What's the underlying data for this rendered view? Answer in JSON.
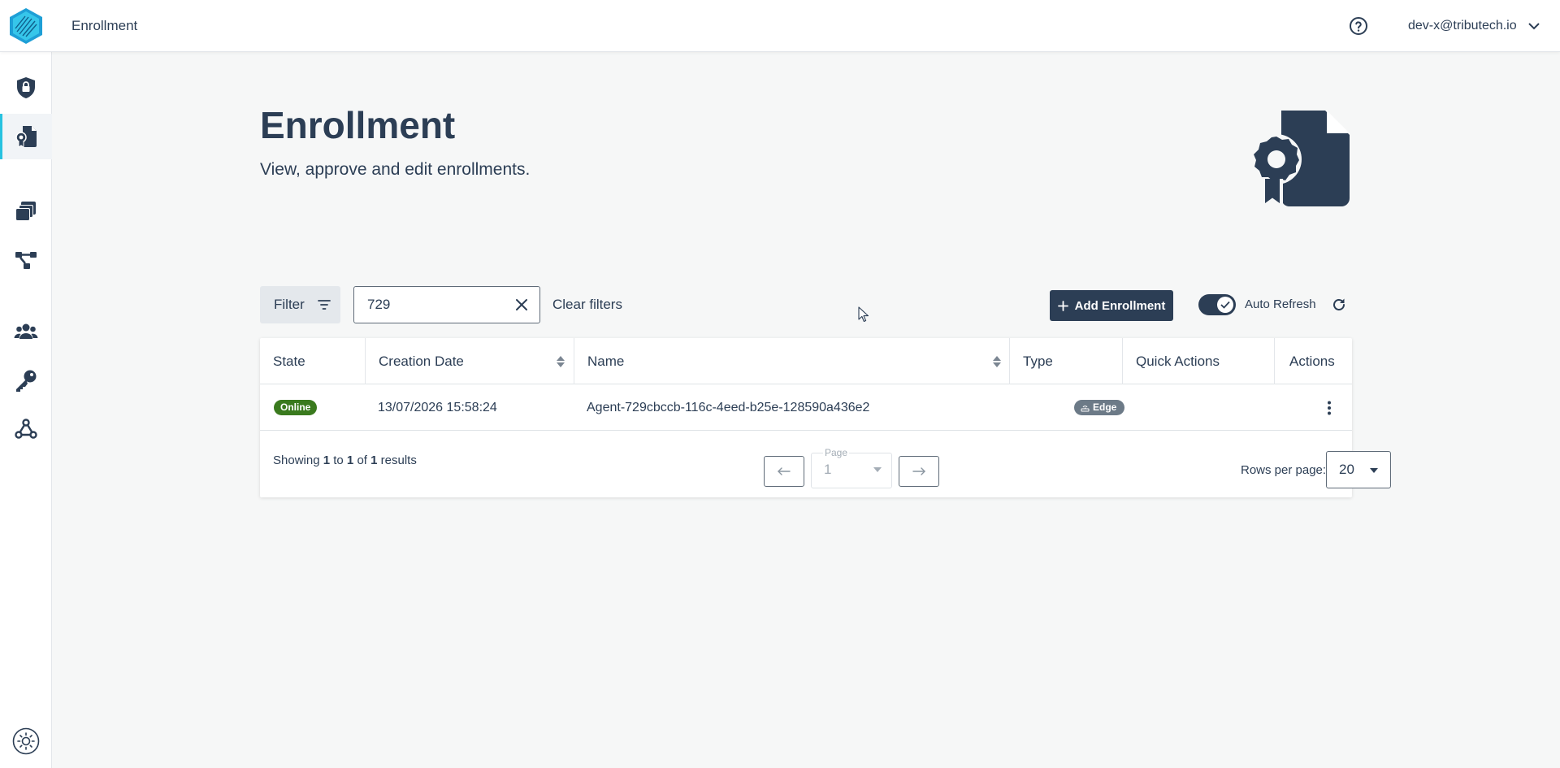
{
  "header": {
    "app_title": "Enrollment",
    "user": "dev-x@tributech.io",
    "icons": [
      "logo-icon",
      "help-icon",
      "chevron-down-icon"
    ]
  },
  "sidebar": {
    "items": [
      {
        "id": "security",
        "icon": "shield-lock-icon",
        "active": false
      },
      {
        "id": "enrollment",
        "icon": "certificate-file-icon",
        "active": true
      },
      {
        "id": "catalog",
        "icon": "layers-icon",
        "active": false
      },
      {
        "id": "nodes",
        "icon": "network-icon",
        "active": false
      },
      {
        "id": "users",
        "icon": "users-icon",
        "active": false
      },
      {
        "id": "keys",
        "icon": "key-icon",
        "active": false
      },
      {
        "id": "webhooks",
        "icon": "webhook-icon",
        "active": false
      }
    ],
    "theme_icon": "sun-icon"
  },
  "page": {
    "title": "Enrollment",
    "subtitle": "View, approve and edit enrollments.",
    "hero_icon": "certificate-file-icon"
  },
  "toolbar": {
    "filter_label": "Filter",
    "search_value": "729",
    "clear_filters_label": "Clear filters",
    "add_label": "Add Enrollment",
    "auto_refresh_label": "Auto Refresh",
    "auto_refresh_on": true
  },
  "table": {
    "columns": [
      "State",
      "Creation Date",
      "Name",
      "Type",
      "Quick Actions",
      "Actions"
    ],
    "rows": [
      {
        "state": "Online",
        "creation_date": "13/07/2026 15:58:24",
        "name": "Agent-729cbccb-116c-4eed-b25e-128590a436e2",
        "type": "Edge"
      }
    ]
  },
  "pagination": {
    "showing_prefix": "Showing",
    "from": "1",
    "to_word": "to",
    "to": "1",
    "of_word": "of",
    "total": "1",
    "results_word": "results",
    "page_label": "Page",
    "page_value": "1",
    "rows_per_page_label": "Rows per page:",
    "rows_per_page_value": "20"
  },
  "colors": {
    "primary": "#2c3e55",
    "accent": "#27c2e0",
    "online": "#3a7a1e",
    "type_badge": "#6c7a87",
    "background": "#f6f7f7"
  }
}
